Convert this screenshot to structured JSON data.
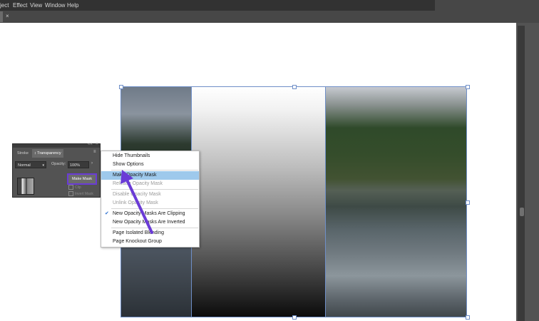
{
  "menubar": {
    "items": [
      "ject",
      "Effect",
      "View",
      "Window",
      "Help"
    ]
  },
  "tabbar": {
    "close_glyph": "×"
  },
  "panel": {
    "collapse_glyph": "««",
    "close_glyph": "×",
    "tabs": [
      {
        "label": "Stroke",
        "active": false
      },
      {
        "label": "↕ Transparency",
        "active": true
      }
    ],
    "menu_glyph": "≡",
    "blend_mode": "Normal",
    "opacity_label": "Opacity:",
    "opacity_value": "100%",
    "opacity_arrow": "›",
    "make_mask_label": "Make Mask",
    "clip_label": "Clip",
    "invert_label": "Invert Mask"
  },
  "context_menu": {
    "items": [
      {
        "label": "Hide Thumbnails",
        "disabled": false
      },
      {
        "label": "Show Options",
        "disabled": false
      },
      {
        "label": "Make Opacity Mask",
        "disabled": false,
        "highlighted": true
      },
      {
        "label": "Release Opacity Mask",
        "disabled": true
      },
      {
        "label": "Disable Opacity Mask",
        "disabled": true
      },
      {
        "label": "Unlink Opacity Mask",
        "disabled": true
      },
      {
        "label": "New Opacity Masks Are Clipping",
        "disabled": false,
        "checked": true
      },
      {
        "label": "New Opacity Masks Are Inverted",
        "disabled": false
      },
      {
        "label": "Page Isolated Blending",
        "disabled": false
      },
      {
        "label": "Page Knockout Group",
        "disabled": false
      }
    ],
    "check_glyph": "✔"
  },
  "colors": {
    "accent_highlight": "#9ec9ec",
    "annotation_purple": "#6a3bd6",
    "selection_blue": "#6f8fc8"
  }
}
